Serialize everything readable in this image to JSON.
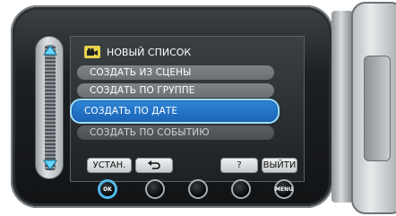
{
  "menu": {
    "title": "НОВЫЙ СПИСОК",
    "title_icon": "movie-camera-icon",
    "items": [
      {
        "label": "СОЗДАТЬ ИЗ СЦЕНЫ",
        "state": "normal"
      },
      {
        "label": "СОЗДАТЬ ПО ГРУППЕ",
        "state": "normal"
      },
      {
        "label": "СОЗДАТЬ ПО ДАТЕ",
        "state": "selected"
      },
      {
        "label": "СОЗДАТЬ ПО СОБЫТИЮ",
        "state": "faded"
      }
    ]
  },
  "soft_buttons": {
    "set": "УСТАН.",
    "back_icon": "back-arrow-icon",
    "help": "?",
    "exit": "ВЫЙТИ"
  },
  "hardware_buttons": {
    "ok": "OK",
    "menu": "MENU"
  },
  "colors": {
    "selected_fill": "#1f6fc4",
    "selected_border": "#9fe0ff",
    "ok_ring": "#53b9ea"
  }
}
